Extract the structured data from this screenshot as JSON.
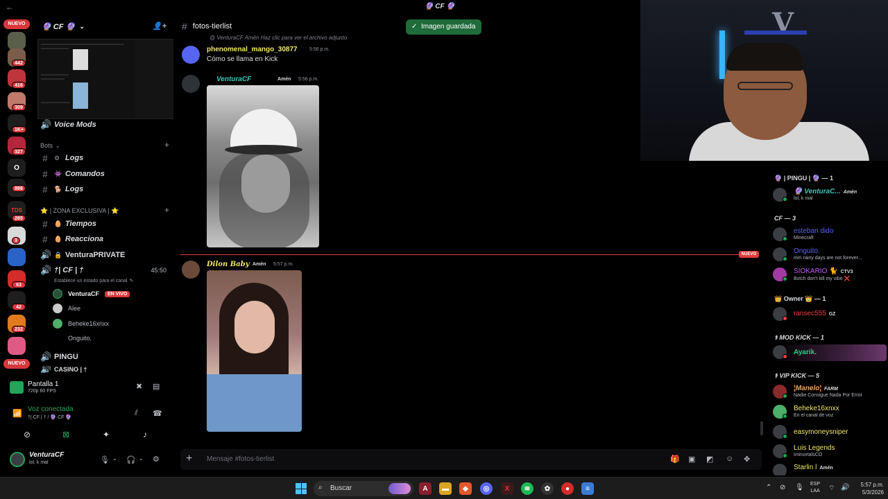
{
  "window": {
    "back_glyph": "←",
    "title": "🔮 CF 🔮"
  },
  "rail": {
    "nuevo_top": "NUEVO",
    "nuevo_bottom": "NUEVO",
    "servers": [
      {
        "badge": "442",
        "color": "#7a5d4a"
      },
      {
        "badge": "416",
        "color": "#c0353b"
      },
      {
        "badge": "309",
        "color": "#c07a6a"
      },
      {
        "badge": "1K+",
        "color": "#1e1e1e"
      },
      {
        "badge": "327",
        "color": "#b3263b"
      },
      {
        "badge": "",
        "letter": "O",
        "color": "#1e1e1e"
      },
      {
        "badge": "886",
        "color": "#1e1e1e"
      },
      {
        "badge": "265",
        "color": "#1e1e1e",
        "letter": "TDS"
      },
      {
        "badge": "3",
        "color": "#d9d9d9"
      },
      {
        "badge": "",
        "color": "#2a63c8"
      },
      {
        "badge": "63",
        "color": "#d42b2b"
      },
      {
        "badge": "42",
        "color": "#1e1e1e"
      },
      {
        "badge": "232",
        "color": "#e07a1d"
      },
      {
        "badge": "",
        "color": "#e05a86"
      }
    ]
  },
  "guild": {
    "name": "CF",
    "name_display": "🔮 CF 🔮"
  },
  "channels": {
    "voice_mods": "Voice Mods",
    "bots_category": "Bots",
    "bot_channels": [
      {
        "icon": "⚙",
        "name": "Logs"
      },
      {
        "icon": "👾",
        "name": "Comandos"
      },
      {
        "icon": "🐕",
        "name": "Logs"
      }
    ],
    "zona_category": "⭐ | ZONA EXCLUSIVA | ⭐",
    "zona_channels": [
      {
        "icon": "🥚",
        "name": "Tiempos",
        "type": "text"
      },
      {
        "icon": "🥚",
        "name": "Reacciona",
        "type": "text"
      },
      {
        "icon": "🔒",
        "name": "VenturaPRIVATE",
        "type": "voice"
      }
    ],
    "voice_channel": {
      "name": "†| CF | †",
      "timer": "45:50",
      "status_prompt": "Establece un estado para el canal"
    },
    "voice_users": [
      {
        "name": "VenturaCF",
        "live": "EN VIVO"
      },
      {
        "name": "Alee"
      },
      {
        "name": "Beheke16xnxx"
      },
      {
        "name": "Onguito."
      }
    ],
    "pingu": "PINGU",
    "casino": "CASINO | †"
  },
  "panel": {
    "screen_title": "Pantalla 1",
    "screen_sub": "720p 60 FPS",
    "voice_status": "Voz conectada",
    "voice_channel": "†| CF | † / 🔮 CF 🔮",
    "me_name": "VenturaCF",
    "me_status": "lol, k mal"
  },
  "chat": {
    "channel_name": "fotos-tierlist",
    "toast": "Imagen guardada",
    "reply_preview": "@ VenturaCF  Amén  Haz clic para ver el archivo adjunto",
    "messages": [
      {
        "author": "phenomenal_mango_30877",
        "time": "5:56 p.m.",
        "text": "Cómo se llama en Kick",
        "color": "#f1e86a"
      },
      {
        "author": "VenturaCF",
        "tag": "Amén",
        "time": "5:56 p.m.",
        "color": "#3fc6b8"
      },
      {
        "author": "Dilon Baby",
        "tag": "Amén",
        "time": "5:57 p.m.",
        "color": "#f1e86a"
      }
    ],
    "new_divider": "NUEVO",
    "composer_placeholder": "Mensaje #fotos-tierlist"
  },
  "members": {
    "groups": [
      {
        "header": "🔮 | PINGU | 🔮 — 1"
      },
      {
        "header": "CF — 3"
      },
      {
        "header": "👑 Owner 👑 — 1"
      },
      {
        "header": "⚕ MOD KICK — 1"
      },
      {
        "header": "⚕ VIP KICK — 5"
      }
    ],
    "list": [
      {
        "name": "🔮 VenturaC...",
        "tag": "Amén",
        "status": "lol, k mal",
        "color": "#3fc6b8",
        "dot": "#23a55a"
      },
      {
        "name": "esteban dido",
        "status": "Minecraft",
        "color": "#5865f2",
        "dot": "#23a55a"
      },
      {
        "name": "Onguito.",
        "status": "mm rainy days are not forever...",
        "color": "#5865f2",
        "dot": "#23a55a"
      },
      {
        "name": "SIOKARIO 🐈",
        "tag": "CTV3",
        "status": "Bxtch don't kill my vibe ❌",
        "color": "#c35df0",
        "dot": "#23a55a"
      },
      {
        "name": "ransec555",
        "tag": "GZ",
        "status": "",
        "color": "#f23f43",
        "dot": "#f23f43"
      },
      {
        "name": "Ayarik.",
        "status": "",
        "color": "#23d18b",
        "dot": "#f23f43"
      },
      {
        "name": "¦Manelo¦",
        "tag": "FARM",
        "status": "Nadie Consigue Nada Por Error",
        "color": "#f2a65a",
        "dot": "#23a55a"
      },
      {
        "name": "Beheke16xnxx",
        "status": "En el canal de voz",
        "color": "#f1e86a",
        "dot": "#23a55a"
      },
      {
        "name": "easymoneysniper",
        "status": "",
        "color": "#f1e86a",
        "dot": "#23a55a"
      },
      {
        "name": "Luis Legends",
        "status": "ImmortalsCO",
        "color": "#f1e86a",
        "dot": "#23a55a"
      },
      {
        "name": "Starlin l",
        "tag": "Amén",
        "status": "",
        "color": "#f1e86a",
        "dot": "#23a55a"
      }
    ]
  },
  "taskbar": {
    "search_placeholder": "Buscar",
    "lang_top": "ESP",
    "lang_bottom": "LAA",
    "time": "5:57 p.m.",
    "date": "5/3/2026"
  },
  "colors": {
    "accent_green": "#23a55a",
    "danger": "#da373c"
  }
}
